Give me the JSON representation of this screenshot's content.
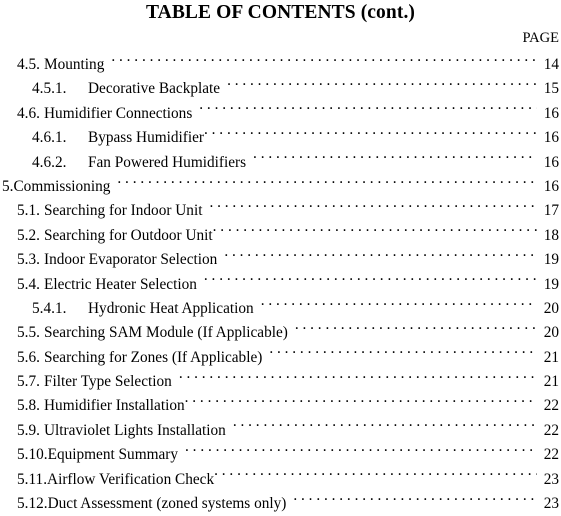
{
  "document": {
    "title": "TABLE OF CONTENTS (cont.)",
    "page_column_header": "PAGE"
  },
  "entries": [
    {
      "number": "4.5.",
      "label": "Mounting",
      "page": "14",
      "level": 1,
      "leader_gap": "wide"
    },
    {
      "number": "4.5.1.",
      "label": "Decorative Backplate",
      "page": "15",
      "level": 2,
      "leader_gap": "wide"
    },
    {
      "number": "4.6.",
      "label": "Humidifier Connections",
      "page": "16",
      "level": 1,
      "leader_gap": "wide"
    },
    {
      "number": "4.6.1.",
      "label": "Bypass Humidifier",
      "page": "16",
      "level": 2,
      "leader_gap": "tight"
    },
    {
      "number": "4.6.2.",
      "label": "Fan Powered Humidifiers",
      "page": "16",
      "level": 2,
      "leader_gap": "wide"
    },
    {
      "number": "5.",
      "label": "Commissioning",
      "page": "16",
      "level": 0,
      "leader_gap": "wide"
    },
    {
      "number": "5.1.",
      "label": "Searching for Indoor Unit",
      "page": "17",
      "level": 1,
      "leader_gap": "wide"
    },
    {
      "number": "5.2.",
      "label": "Searching for Outdoor Unit",
      "page": "18",
      "level": 1,
      "leader_gap": "tight"
    },
    {
      "number": "5.3.",
      "label": "Indoor Evaporator Selection",
      "page": "19",
      "level": 1,
      "leader_gap": "wide"
    },
    {
      "number": "5.4.",
      "label": "Electric Heater Selection",
      "page": "19",
      "level": 1,
      "leader_gap": "wide"
    },
    {
      "number": "5.4.1.",
      "label": "Hydronic Heat Application",
      "page": "20",
      "level": 2,
      "leader_gap": "wide"
    },
    {
      "number": "5.5.",
      "label": "Searching SAM Module (If Applicable)",
      "page": "20",
      "level": 1,
      "leader_gap": "wide"
    },
    {
      "number": "5.6.",
      "label": "Searching for Zones (If Applicable)",
      "page": "21",
      "level": 1,
      "leader_gap": "wide"
    },
    {
      "number": "5.7.",
      "label": "Filter Type Selection",
      "page": "21",
      "level": 1,
      "leader_gap": "wide"
    },
    {
      "number": "5.8.",
      "label": "Humidifier Installation",
      "page": "22",
      "level": 1,
      "leader_gap": "tight"
    },
    {
      "number": "5.9.",
      "label": "Ultraviolet Lights Installation",
      "page": "22",
      "level": 1,
      "leader_gap": "wide"
    },
    {
      "number": "5.10.",
      "label": "Equipment Summary",
      "page": "22",
      "level": 1,
      "leader_gap": "wide"
    },
    {
      "number": "5.11.",
      "label": "Airflow Verification Check",
      "page": "23",
      "level": 1,
      "leader_gap": "tight"
    },
    {
      "number": "5.12.",
      "label": "Duct Assessment (zoned systems only)",
      "page": "23",
      "level": 1,
      "leader_gap": "wide"
    }
  ],
  "colors": {
    "text": "#000000",
    "background": "#ffffff"
  }
}
